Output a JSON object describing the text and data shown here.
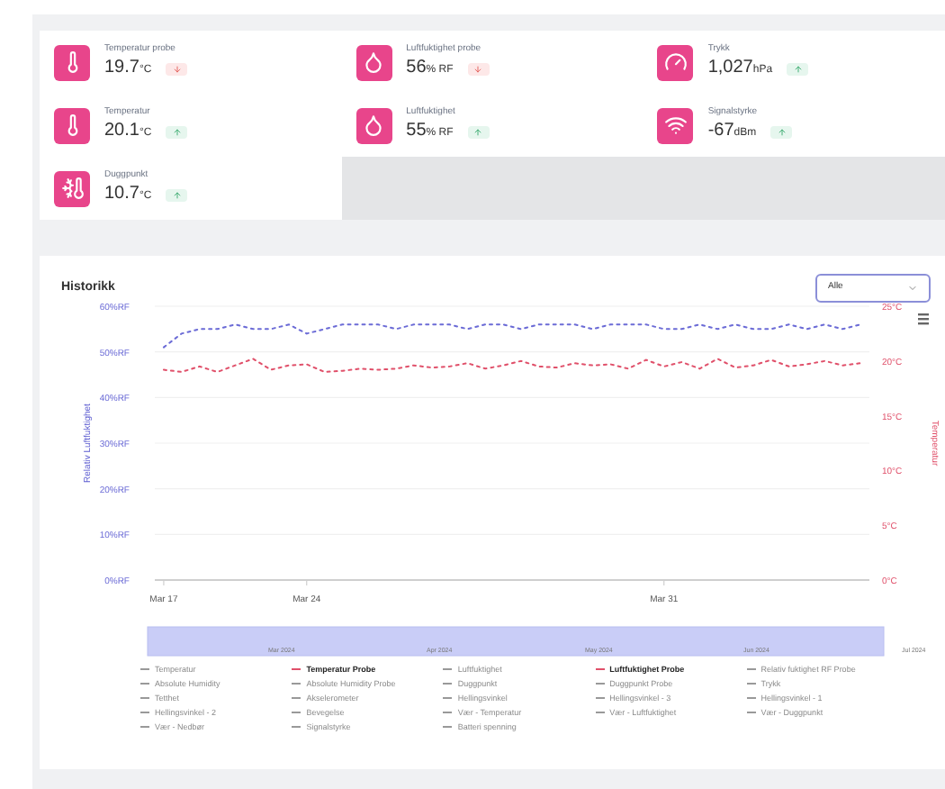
{
  "cards": [
    {
      "kind": "temperature",
      "label": "Temperatur probe",
      "value": "19.7",
      "unit": "°C",
      "rising": false
    },
    {
      "kind": "humidity",
      "label": "Luftfuktighet probe",
      "value": "56",
      "unit": "% RF",
      "rising": false
    },
    {
      "kind": "pressure",
      "label": "Trykk",
      "value": "1,027",
      "unit": "hPa",
      "rising": true
    },
    {
      "kind": "temperature",
      "label": "Temperatur",
      "value": "20.1",
      "unit": "°C",
      "rising": true
    },
    {
      "kind": "humidity",
      "label": "Luftfuktighet",
      "value": "55",
      "unit": "% RF",
      "rising": true
    },
    {
      "kind": "signal",
      "label": "Signalstyrke",
      "value": "-67",
      "unit": "dBm",
      "rising": true
    },
    {
      "kind": "dewpoint",
      "label": "Duggpunkt",
      "value": "10.7",
      "unit": "°C",
      "rising": true
    }
  ],
  "history": {
    "title": "Historikk",
    "range_select": {
      "value": "Alle"
    },
    "navigator_labels": [
      "Mar 2024",
      "Apr 2024",
      "May 2024",
      "Jun 2024",
      "Jul 2024"
    ],
    "chart_data": {
      "type": "line",
      "grid": true,
      "ylabel": "Relativ Luftfuktighet",
      "y2label": "Temperatur",
      "y2lim": [
        0,
        25
      ],
      "y2ticks": [
        {
          "value": 25,
          "label": "25°C"
        },
        {
          "value": 20,
          "label": "20°C"
        },
        {
          "value": 15,
          "label": "15°C"
        },
        {
          "value": 10,
          "label": "10°C"
        },
        {
          "value": 5,
          "label": "5°C"
        },
        {
          "value": 0,
          "label": "0°C"
        }
      ],
      "categories": [
        "Mar 17",
        null,
        null,
        null,
        null,
        null,
        null,
        null,
        "Mar 24",
        null,
        null,
        null,
        null,
        null,
        null,
        null,
        null,
        null,
        null,
        null,
        null,
        null,
        null,
        null,
        null,
        null,
        null,
        null,
        "Mar 31",
        null,
        null,
        null,
        null,
        null,
        null,
        null,
        null,
        null,
        null,
        null
      ],
      "ylim": [
        0,
        60
      ],
      "yticks": [
        {
          "value": 60,
          "label": "60%RF"
        },
        {
          "value": 50,
          "label": "50%RF"
        },
        {
          "value": 40,
          "label": "40%RF"
        },
        {
          "value": 30,
          "label": "30%RF"
        },
        {
          "value": 20,
          "label": "20%RF"
        },
        {
          "value": 10,
          "label": "10%RF"
        },
        {
          "value": 0,
          "label": "0%RF"
        }
      ],
      "series": [
        {
          "color": "#6b6bd6",
          "line_style": "dashed",
          "values": [
            51,
            54,
            55,
            55,
            56,
            55,
            55,
            56,
            54,
            55,
            56,
            56,
            56,
            55,
            56,
            56,
            56,
            55,
            56,
            56,
            55,
            56,
            56,
            56,
            55,
            56,
            56,
            56,
            55,
            55,
            56,
            55,
            56,
            55,
            55,
            56,
            55,
            56,
            55,
            56
          ]
        },
        {
          "color": "#e0506a",
          "axis": "y2",
          "line_style": "dashed",
          "values": [
            19.2,
            19,
            19.5,
            19,
            19.6,
            20.2,
            19.2,
            19.6,
            19.7,
            19,
            19.1,
            19.3,
            19.2,
            19.3,
            19.6,
            19.4,
            19.5,
            19.8,
            19.3,
            19.6,
            20,
            19.5,
            19.4,
            19.8,
            19.6,
            19.7,
            19.3,
            20.1,
            19.5,
            19.9,
            19.3,
            20.2,
            19.4,
            19.6,
            20.1,
            19.5,
            19.7,
            20,
            19.6,
            19.8
          ]
        }
      ]
    },
    "legend": [
      {
        "label": "Temperatur",
        "selected": false
      },
      {
        "label": "Temperatur Probe",
        "selected": true
      },
      {
        "label": "Luftfuktighet",
        "selected": false
      },
      {
        "label": "Luftfuktighet Probe",
        "selected": true
      },
      {
        "label": "Relativ fuktighet RF Probe",
        "selected": false
      },
      {
        "label": "Absolute Humidity",
        "selected": false
      },
      {
        "label": "Absolute Humidity Probe",
        "selected": false
      },
      {
        "label": "Duggpunkt",
        "selected": false
      },
      {
        "label": "Duggpunkt Probe",
        "selected": false
      },
      {
        "label": "Trykk",
        "selected": false
      },
      {
        "label": "Tetthet",
        "selected": false
      },
      {
        "label": "Akselerometer",
        "selected": false
      },
      {
        "label": "Hellingsvinkel",
        "selected": false
      },
      {
        "label": "Hellingsvinkel - 3",
        "selected": false
      },
      {
        "label": "Hellingsvinkel - 1",
        "selected": false
      },
      {
        "label": "Hellingsvinkel - 2",
        "selected": false
      },
      {
        "label": "Bevegelse",
        "selected": false
      },
      {
        "label": "Vær - Temperatur",
        "selected": false
      },
      {
        "label": "Vær - Luftfuktighet",
        "selected": false
      },
      {
        "label": "Vær - Duggpunkt",
        "selected": false
      },
      {
        "label": "Vær - Nedbør",
        "selected": false
      },
      {
        "label": "Signalstyrke",
        "selected": false
      },
      {
        "label": "Batteri spenning",
        "selected": false
      }
    ]
  }
}
